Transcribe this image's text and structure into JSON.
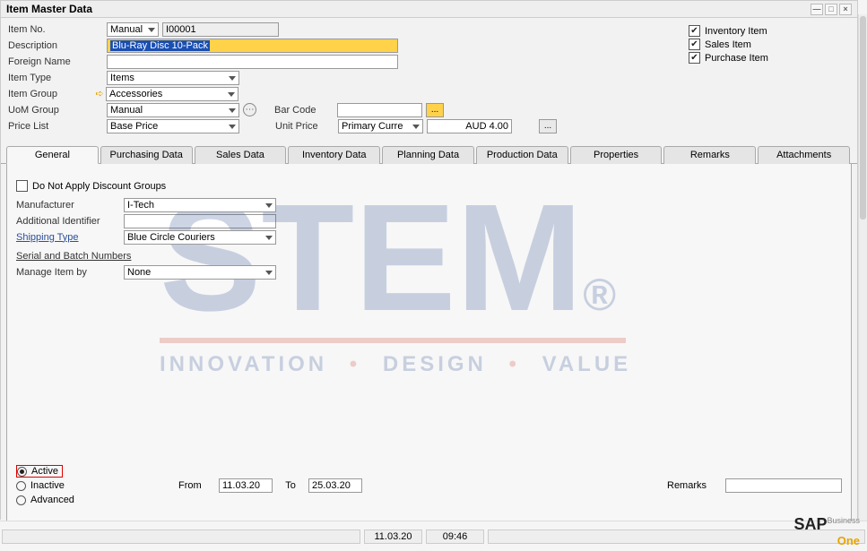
{
  "window": {
    "title": "Item Master Data"
  },
  "header": {
    "item_no_label": "Item No.",
    "item_no_type": "Manual",
    "item_no_value": "I00001",
    "description_label": "Description",
    "description_value": "Blu-Ray Disc 10-Pack",
    "foreign_name_label": "Foreign Name",
    "foreign_name_value": "",
    "item_type_label": "Item Type",
    "item_type_value": "Items",
    "item_group_label": "Item Group",
    "item_group_value": "Accessories",
    "uom_group_label": "UoM Group",
    "uom_group_value": "Manual",
    "price_list_label": "Price List",
    "price_list_value": "Base Price",
    "bar_code_label": "Bar Code",
    "bar_code_value": "",
    "unit_price_label": "Unit Price",
    "unit_price_currency": "Primary Curre",
    "unit_price_amount": "AUD 4.00"
  },
  "checks": {
    "inventory": "Inventory Item",
    "sales": "Sales Item",
    "purchase": "Purchase Item"
  },
  "tabs": {
    "general": "General",
    "purchasing": "Purchasing Data",
    "sales": "Sales Data",
    "inventory": "Inventory Data",
    "planning": "Planning Data",
    "production": "Production Data",
    "properties": "Properties",
    "remarks": "Remarks",
    "attachments": "Attachments"
  },
  "general_tab": {
    "discount_groups_label": "Do Not Apply Discount Groups",
    "manufacturer_label": "Manufacturer",
    "manufacturer_value": "I-Tech",
    "additional_id_label": "Additional Identifier",
    "additional_id_value": "",
    "shipping_type_label": "Shipping Type",
    "shipping_type_value": "Blue Circle Couriers",
    "serial_batch_label": "Serial and Batch Numbers",
    "manage_item_label": "Manage Item by",
    "manage_item_value": "None",
    "active_label": "Active",
    "inactive_label": "Inactive",
    "advanced_label": "Advanced",
    "from_label": "From",
    "from_value": "11.03.20",
    "to_label": "To",
    "to_value": "25.03.20",
    "remarks_label": "Remarks",
    "remarks_value": ""
  },
  "watermark": {
    "brand": "STEM",
    "tagline_1": "INNOVATION",
    "tagline_2": "DESIGN",
    "tagline_3": "VALUE"
  },
  "status": {
    "date": "11.03.20",
    "time": "09:46"
  },
  "logo": {
    "sap": "SAP",
    "business": "Business",
    "one": "One"
  }
}
